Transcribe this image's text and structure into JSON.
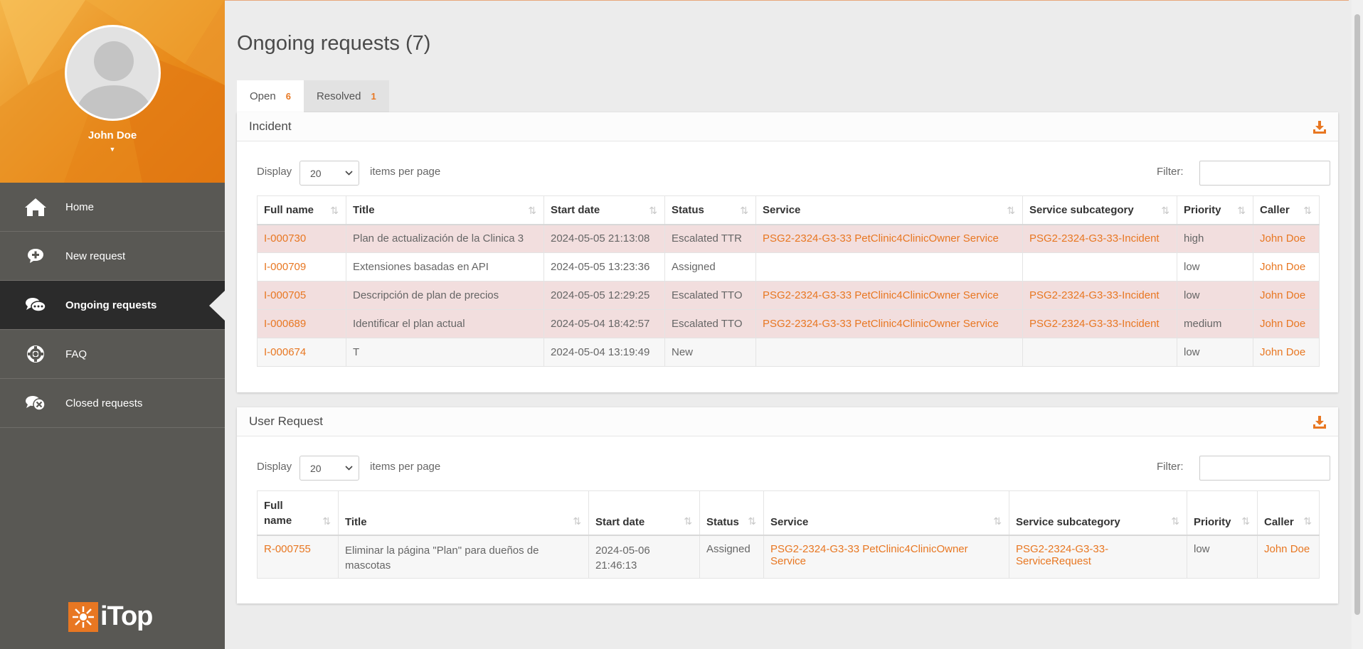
{
  "user": {
    "name": "John Doe"
  },
  "menu": {
    "items": [
      {
        "label": "Home",
        "icon": "home-icon"
      },
      {
        "label": "New request",
        "icon": "add-request-icon"
      },
      {
        "label": "Ongoing requests",
        "icon": "chat-bubbles-icon"
      },
      {
        "label": "FAQ",
        "icon": "lifebuoy-icon"
      },
      {
        "label": "Closed requests",
        "icon": "closed-request-icon"
      }
    ]
  },
  "logo": {
    "text": "iTop"
  },
  "page": {
    "title": "Ongoing requests (7)"
  },
  "tabs": [
    {
      "label": "Open",
      "count": "6"
    },
    {
      "label": "Resolved",
      "count": "1"
    }
  ],
  "incident": {
    "title": "Incident",
    "display_label": "Display",
    "page_size": "20",
    "ipp_label": "items per page",
    "filter_label": "Filter:",
    "columns": [
      "Full name",
      "Title",
      "Start date",
      "Status",
      "Service",
      "Service subcategory",
      "Priority",
      "Caller"
    ],
    "rows": [
      {
        "id": "I-000730",
        "title": "Plan de actualización de la Clinica 3",
        "start": "2024-05-05 21:13:08",
        "status": "Escalated TTR",
        "service": "PSG2-2324-G3-33 PetClinic4ClinicOwner Service",
        "subcat": "PSG2-2324-G3-33-Incident",
        "priority": "high",
        "caller": "John Doe"
      },
      {
        "id": "I-000709",
        "title": "Extensiones basadas en API",
        "start": "2024-05-05 13:23:36",
        "status": "Assigned",
        "service": "",
        "subcat": "",
        "priority": "low",
        "caller": "John Doe"
      },
      {
        "id": "I-000705",
        "title": "Descripción de plan de precios",
        "start": "2024-05-05 12:29:25",
        "status": "Escalated TTO",
        "service": "PSG2-2324-G3-33 PetClinic4ClinicOwner Service",
        "subcat": "PSG2-2324-G3-33-Incident",
        "priority": "low",
        "caller": "John Doe"
      },
      {
        "id": "I-000689",
        "title": "Identificar el plan actual",
        "start": "2024-05-04 18:42:57",
        "status": "Escalated TTO",
        "service": "PSG2-2324-G3-33 PetClinic4ClinicOwner Service",
        "subcat": "PSG2-2324-G3-33-Incident",
        "priority": "medium",
        "caller": "John Doe"
      },
      {
        "id": "I-000674",
        "title": "T",
        "start": "2024-05-04 13:19:49",
        "status": "New",
        "service": "",
        "subcat": "",
        "priority": "low",
        "caller": "John Doe"
      }
    ]
  },
  "user_request": {
    "title": "User Request",
    "display_label": "Display",
    "page_size": "20",
    "ipp_label": "items per page",
    "filter_label": "Filter:",
    "columns": [
      "Full name",
      "Title",
      "Start date",
      "Status",
      "Service",
      "Service subcategory",
      "Priority",
      "Caller"
    ],
    "rows": [
      {
        "id": "R-000755",
        "title": "Eliminar la página \"Plan\" para dueños de mascotas",
        "start": "2024-05-06 21:46:13",
        "status": "Assigned",
        "service": "PSG2-2324-G3-33 PetClinic4ClinicOwner Service",
        "subcat": "PSG2-2324-G3-33-ServiceRequest",
        "priority": "low",
        "caller": "John Doe"
      }
    ]
  },
  "colors": {
    "accent": "#e87722",
    "sidebar": "#595854",
    "escalated_row": "#f2dede"
  }
}
